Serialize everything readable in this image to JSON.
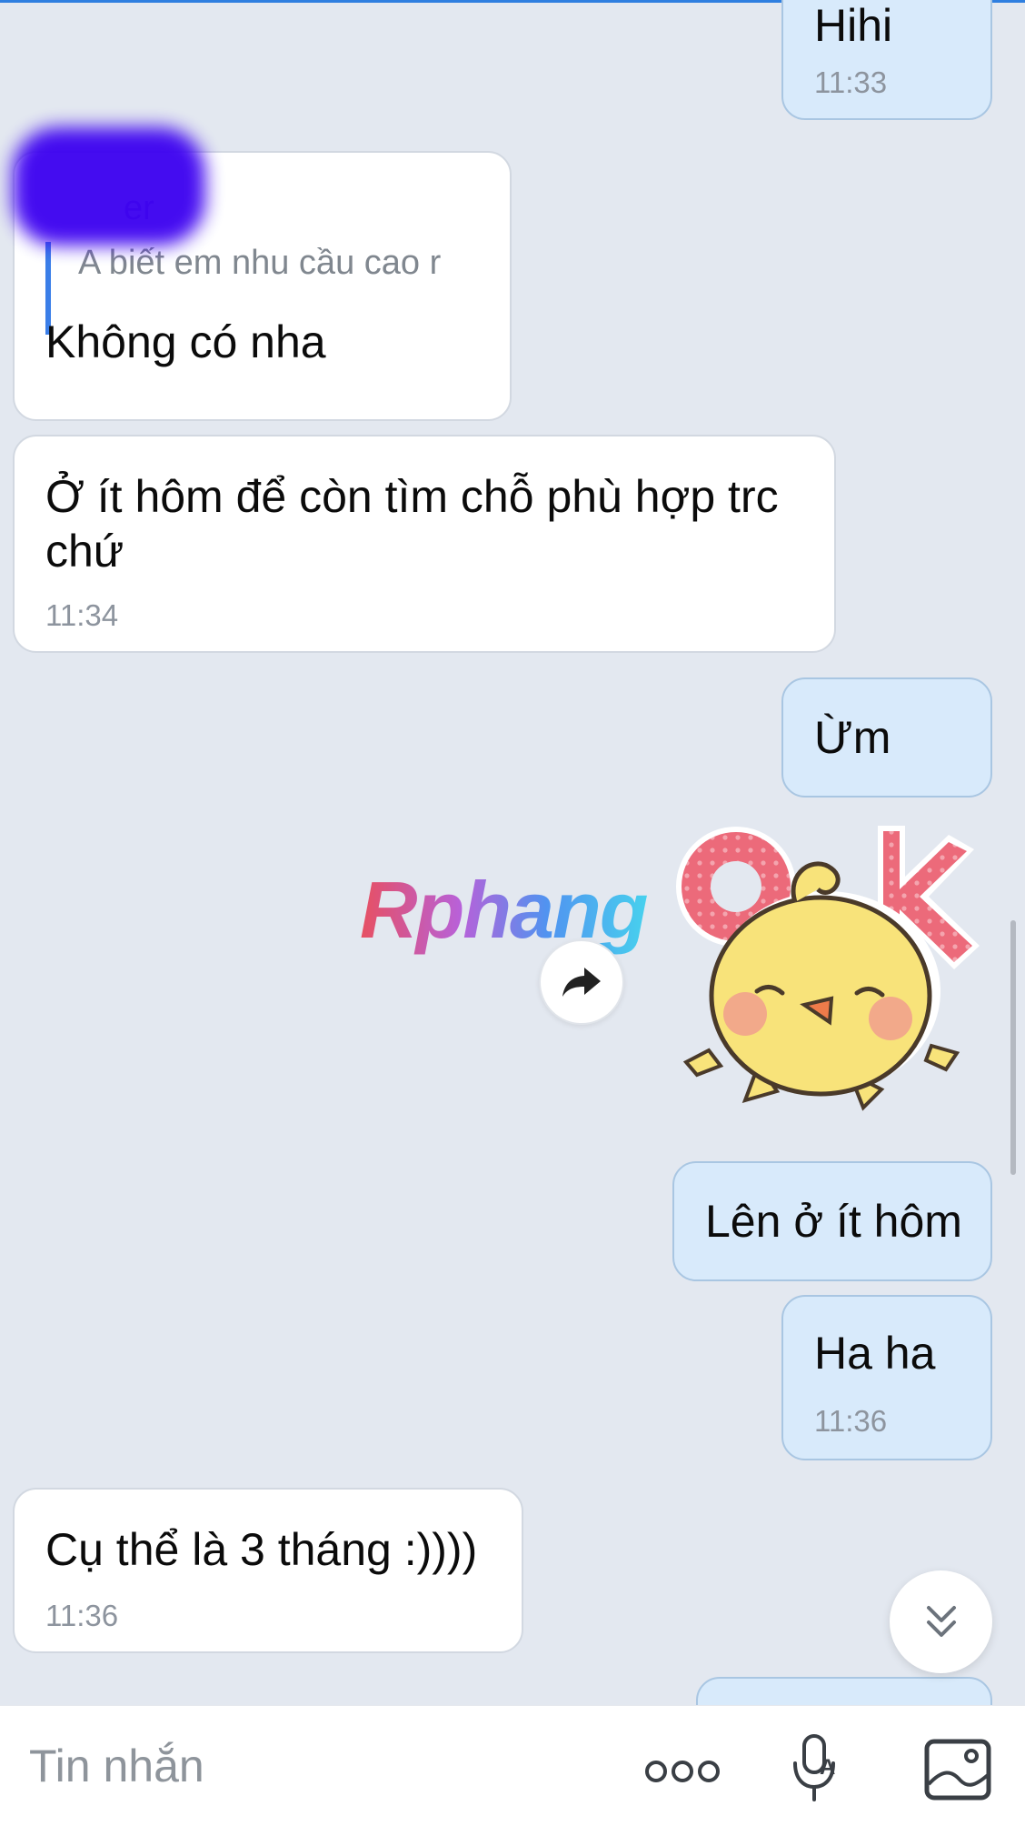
{
  "messages": [
    {
      "side": "out",
      "text": "Hihi",
      "time": "11:33"
    },
    {
      "side": "in",
      "quote_sender": "er",
      "quote_text": "A biết em nhu cầu cao r",
      "text": "Không có nha"
    },
    {
      "side": "in",
      "text": "Ở ít hôm để còn tìm chỗ phù hợp trc\nchứ",
      "time": "11:34"
    },
    {
      "side": "out",
      "text": "Ừm"
    },
    {
      "side": "out",
      "text": "Lên ở ít hôm"
    },
    {
      "side": "out",
      "text": "Ha ha",
      "time": "11:36"
    },
    {
      "side": "in",
      "text": "Cụ thể là 3 tháng :))))",
      "time": "11:36"
    }
  ],
  "sticker": {
    "icon": "ok-chick-sticker",
    "text": "OK"
  },
  "watermark": "Rphang",
  "composer": {
    "placeholder": "Tin nhắn"
  },
  "icons": {
    "forward": "forward-arrow-icon",
    "scroll": "chevron-double-down-icon",
    "more": "more-dots-icon",
    "voice": "microphone-icon",
    "image": "image-icon"
  },
  "colors": {
    "accent": "#3a7ee8",
    "incoming": "#ffffff",
    "outgoing": "#d8eafb",
    "background": "#e3e8f0"
  }
}
